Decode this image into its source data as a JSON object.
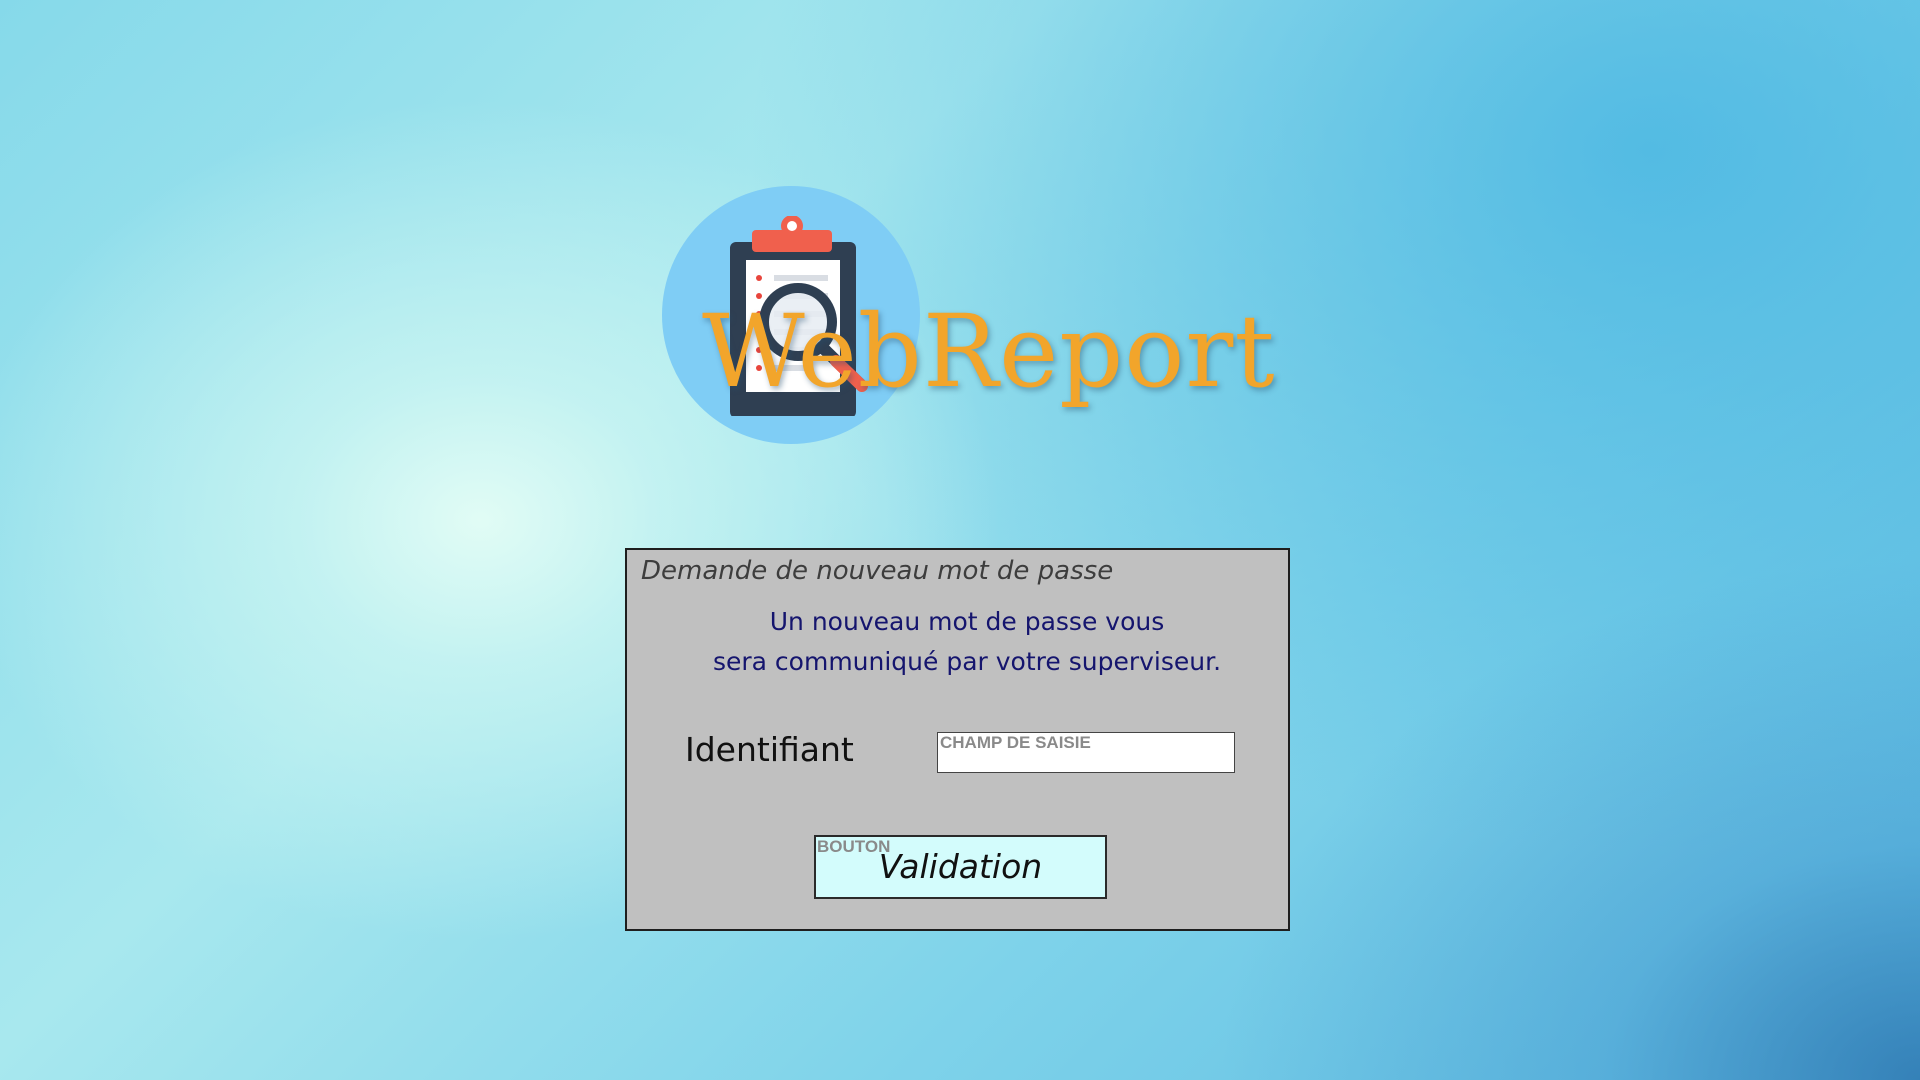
{
  "logo": {
    "text": "WebReport",
    "icon": "clipboard-magnifier-icon",
    "text_color": "#f2a52b",
    "circle_color": "#7fcdf5"
  },
  "panel": {
    "title": "Demande de nouveau mot de passe",
    "info_line_1": "Un nouveau mot de passe vous",
    "info_line_2": "sera communiqué par votre superviseur.",
    "identifier_label": "Identifiant",
    "identifier_field_tag": "CHAMP DE SAISIE",
    "identifier_value": "",
    "button_tag": "BOUTON",
    "button_label": "Validation",
    "background_color": "#c0c0c0",
    "button_color": "#d3fcfc"
  }
}
